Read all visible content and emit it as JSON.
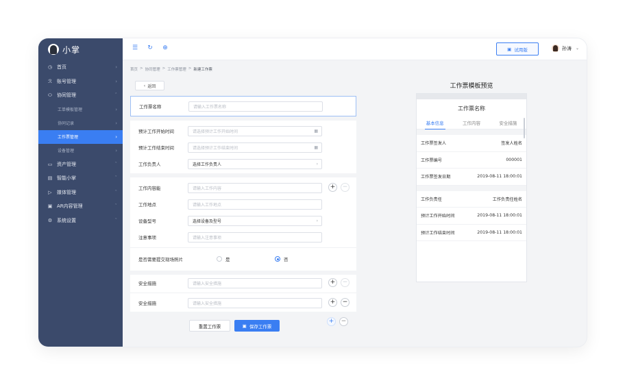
{
  "sidebar": {
    "logo_text": "小掌",
    "items": [
      {
        "icon": "home-icon",
        "glyph": "◷",
        "label": "首页"
      },
      {
        "icon": "account-icon",
        "glyph": "ℛ",
        "label": "账号管理"
      },
      {
        "icon": "collab-icon",
        "glyph": "⬭",
        "label": "协同管理"
      }
    ],
    "subitems": [
      {
        "label": "工单模板管理"
      },
      {
        "label": "协同记录"
      },
      {
        "label": "工作票管理"
      },
      {
        "label": "设备管理"
      }
    ],
    "items2": [
      {
        "icon": "asset-icon",
        "glyph": "▭",
        "label": "资产管理"
      },
      {
        "icon": "smart-icon",
        "glyph": "▤",
        "label": "智能小掌"
      },
      {
        "icon": "media-icon",
        "glyph": "▷",
        "label": "媒体管理"
      },
      {
        "icon": "ar-icon",
        "glyph": "▣",
        "label": "AR内容管理"
      },
      {
        "icon": "settings-icon",
        "glyph": "⚙",
        "label": "系统设置"
      }
    ]
  },
  "topbar": {
    "icons": [
      "menu-icon",
      "refresh-icon",
      "globe-icon"
    ],
    "trial_label": "试用版",
    "user_name": "孙涛"
  },
  "breadcrumb": [
    "首页",
    "协同管理",
    "工作票管理",
    "新建工作票"
  ],
  "back_label": "返回",
  "form": {
    "name": {
      "label": "工作票名称",
      "placeholder": "请输入工作票名称"
    },
    "start": {
      "label": "预计工作开始时间",
      "placeholder": "请选择预计工作开始时间"
    },
    "end": {
      "label": "预计工作结束时间",
      "placeholder": "请选择预计工作结束时间"
    },
    "owner": {
      "label": "工作负责人",
      "value": "选择工作负责人"
    },
    "content": {
      "label": "工作内容能",
      "placeholder": "请输入工作内容"
    },
    "place": {
      "label": "工作地点",
      "placeholder": "请输入工作地点"
    },
    "device": {
      "label": "设备型号",
      "value": "选择设备及型号"
    },
    "notes": {
      "label": "注意事项",
      "placeholder": "请输入注意事项"
    },
    "photo": {
      "label": "是否需要提交现场照片",
      "yes": "是",
      "no": "否",
      "selected": "否"
    },
    "safety1": {
      "label": "安全措施",
      "placeholder": "请输入安全措施"
    },
    "safety2": {
      "label": "安全措施",
      "placeholder": "请输入安全措施"
    }
  },
  "buttons": {
    "reset": "重置工作票",
    "save": "保存工作票"
  },
  "preview": {
    "title": "工作票模板预览",
    "name": "工作票名称",
    "tabs": [
      "基本信息",
      "工作内容",
      "安全措施"
    ],
    "rows1": [
      {
        "k": "工作票签发人",
        "v": "签发人姓名"
      },
      {
        "k": "工作票编号",
        "v": "000001"
      },
      {
        "k": "工作票签发日期",
        "v": "2019-08-11 18:00:01"
      }
    ],
    "rows2": [
      {
        "k": "工作负责任",
        "v": "工作负责任姓名"
      },
      {
        "k": "预计工作开始时间",
        "v": "2019-08-11 18:00:01"
      },
      {
        "k": "预计工作结束时间",
        "v": "2019-08-11 18:00:01"
      }
    ]
  }
}
